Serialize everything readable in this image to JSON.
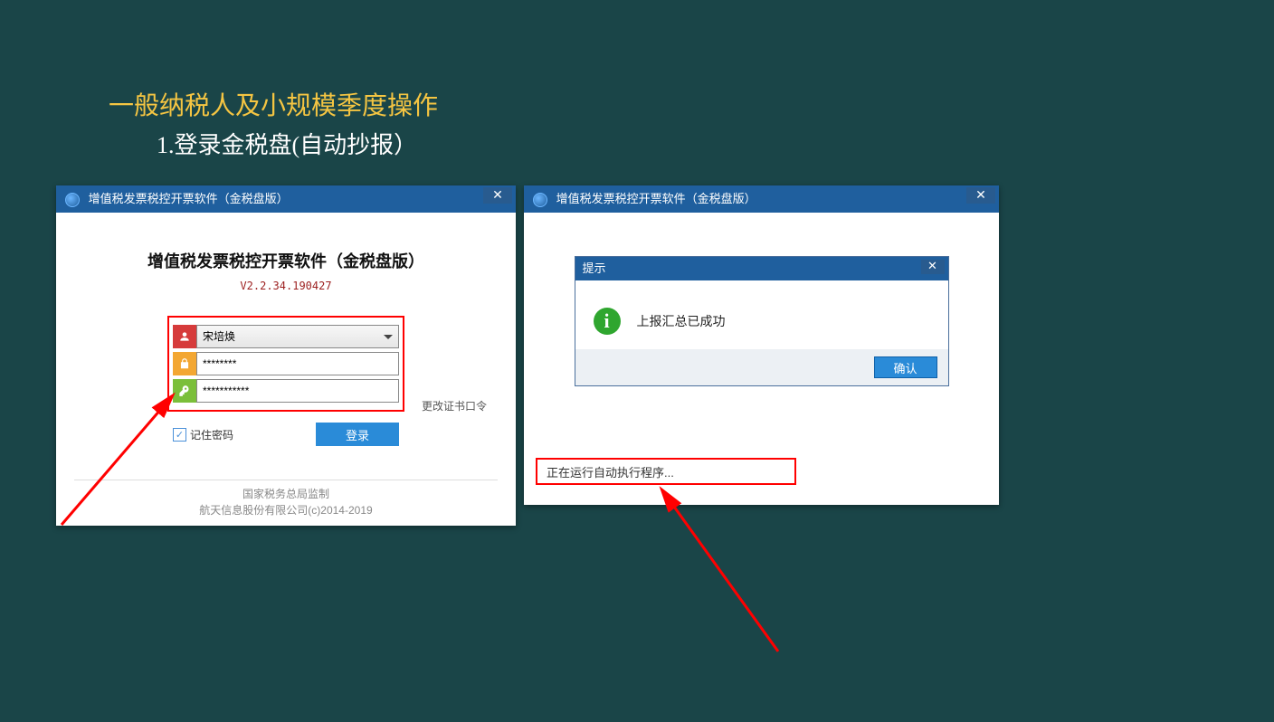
{
  "slide": {
    "title": "一般纳税人及小规模季度操作",
    "subtitle": "1.登录金税盘(自动抄报）"
  },
  "leftWin": {
    "titlebar": "增值税发票税控开票软件（金税盘版）",
    "heading": "增值税发票税控开票软件（金税盘版）",
    "version": "V2.2.34.190427",
    "user": "宋培焕",
    "passMask": "********",
    "certMask": "***********",
    "changeCert": "更改证书口令",
    "remember": "记住密码",
    "loginBtn": "登录",
    "footer1": "国家税务总局监制",
    "footer2": "航天信息股份有限公司(c)2014-2019"
  },
  "rightWin": {
    "titlebar": "增值税发票税控开票软件（金税盘版）",
    "dlgTitle": "提示",
    "dlgMsg": "上报汇总已成功",
    "okBtn": "确认",
    "status": "正在运行自动执行程序..."
  }
}
